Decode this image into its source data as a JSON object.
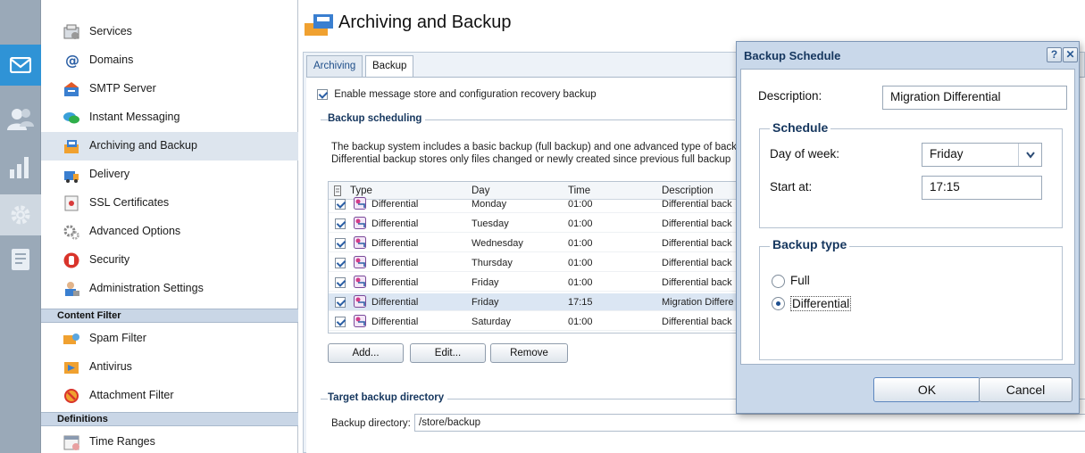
{
  "rail": {
    "items": [
      {
        "icon": "mail-icon",
        "active": true
      },
      {
        "icon": "users-icon"
      },
      {
        "icon": "stats-icon"
      },
      {
        "icon": "settings-gear-icon",
        "selected": true
      },
      {
        "icon": "document-icon"
      }
    ]
  },
  "nav": {
    "items": [
      {
        "label": "Services",
        "icon": "services-icon"
      },
      {
        "label": "Domains",
        "icon": "at-icon"
      },
      {
        "label": "SMTP Server",
        "icon": "smtp-server-icon"
      },
      {
        "label": "Instant Messaging",
        "icon": "chat-bubbles-icon"
      },
      {
        "label": "Archiving and Backup",
        "icon": "archive-icon",
        "selected": true
      },
      {
        "label": "Delivery",
        "icon": "delivery-icon"
      },
      {
        "label": "SSL Certificates",
        "icon": "certificate-icon"
      },
      {
        "label": "Advanced Options",
        "icon": "gears-icon"
      },
      {
        "label": "Security",
        "icon": "stop-hand-icon"
      },
      {
        "label": "Administration Settings",
        "icon": "admin-icon"
      }
    ],
    "content_filter_label": "Content Filter",
    "content_filter_items": [
      {
        "label": "Spam Filter",
        "icon": "spam-icon"
      },
      {
        "label": "Antivirus",
        "icon": "antivirus-icon"
      },
      {
        "label": "Attachment Filter",
        "icon": "attachment-filter-icon"
      }
    ],
    "definitions_label": "Definitions",
    "definitions_items": [
      {
        "label": "Time Ranges",
        "icon": "calendar-icon"
      }
    ]
  },
  "main": {
    "title": "Archiving and Backup",
    "tabs": [
      {
        "label": "Archiving"
      },
      {
        "label": "Backup",
        "active": true
      }
    ],
    "enable_label": "Enable message store and configuration recovery backup",
    "enable_checked": true,
    "scheduling_title": "Backup scheduling",
    "scheduling_desc_1": "The backup system includes a basic backup (full backup) and one advanced type of back",
    "scheduling_desc_2": "Differential backup stores only files changed or newly created since previous full backup",
    "table": {
      "columns": [
        "Type",
        "Day",
        "Time",
        "Description"
      ],
      "rows": [
        {
          "type": "Differential",
          "day": "Monday",
          "time": "01:00",
          "description": "Differential back"
        },
        {
          "type": "Differential",
          "day": "Tuesday",
          "time": "01:00",
          "description": "Differential back"
        },
        {
          "type": "Differential",
          "day": "Wednesday",
          "time": "01:00",
          "description": "Differential back"
        },
        {
          "type": "Differential",
          "day": "Thursday",
          "time": "01:00",
          "description": "Differential back"
        },
        {
          "type": "Differential",
          "day": "Friday",
          "time": "01:00",
          "description": "Differential back"
        },
        {
          "type": "Differential",
          "day": "Friday",
          "time": "17:15",
          "description": "Migration Differe",
          "highlighted": true
        },
        {
          "type": "Differential",
          "day": "Saturday",
          "time": "01:00",
          "description": "Differential back"
        }
      ]
    },
    "buttons": {
      "add": "Add...",
      "edit": "Edit...",
      "remove": "Remove"
    },
    "target_title": "Target backup directory",
    "backup_dir_label": "Backup directory:",
    "backup_dir_value": "/store/backup"
  },
  "dialog": {
    "title": "Backup Schedule",
    "help_label": "?",
    "close_label": "✕",
    "description_label": "Description:",
    "description_value": "Migration Differential",
    "schedule_legend": "Schedule",
    "day_label": "Day of week:",
    "day_value": "Friday",
    "start_label": "Start at:",
    "start_value": "17:15",
    "backup_type_legend": "Backup type",
    "option_full": "Full",
    "option_differential": "Differential",
    "selected_option": "Differential",
    "ok_label": "OK",
    "cancel_label": "Cancel"
  },
  "colors": {
    "accent": "#2f93d6",
    "nav_selected": "#dde5ee",
    "section_header": "#c9d6e6",
    "dialog_frame": "#c9d8ea",
    "title_text": "#15365e"
  }
}
